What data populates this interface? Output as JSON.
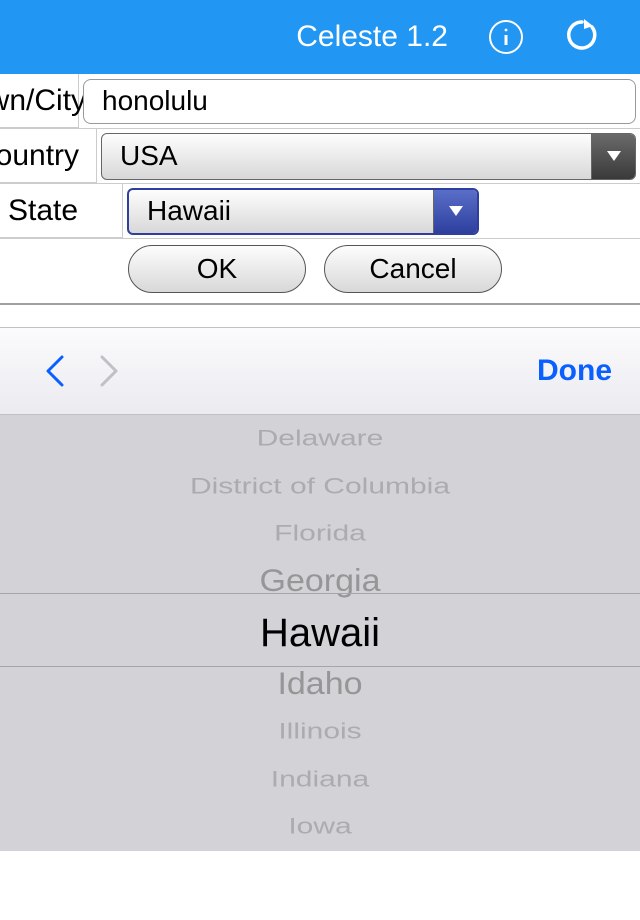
{
  "header": {
    "title": "Celeste 1.2"
  },
  "form": {
    "city_label": "Town/City",
    "city_value": "honolulu",
    "country_label": "Country",
    "country_value": "USA",
    "state_label": "State",
    "state_value": "Hawaii",
    "ok_label": "OK",
    "cancel_label": "Cancel"
  },
  "accessory": {
    "done_label": "Done"
  },
  "picker": {
    "items": [
      "Delaware",
      "District of Columbia",
      "Florida",
      "Georgia",
      "Hawaii",
      "Idaho",
      "Illinois",
      "Indiana",
      "Iowa"
    ],
    "selected_index": 4
  }
}
